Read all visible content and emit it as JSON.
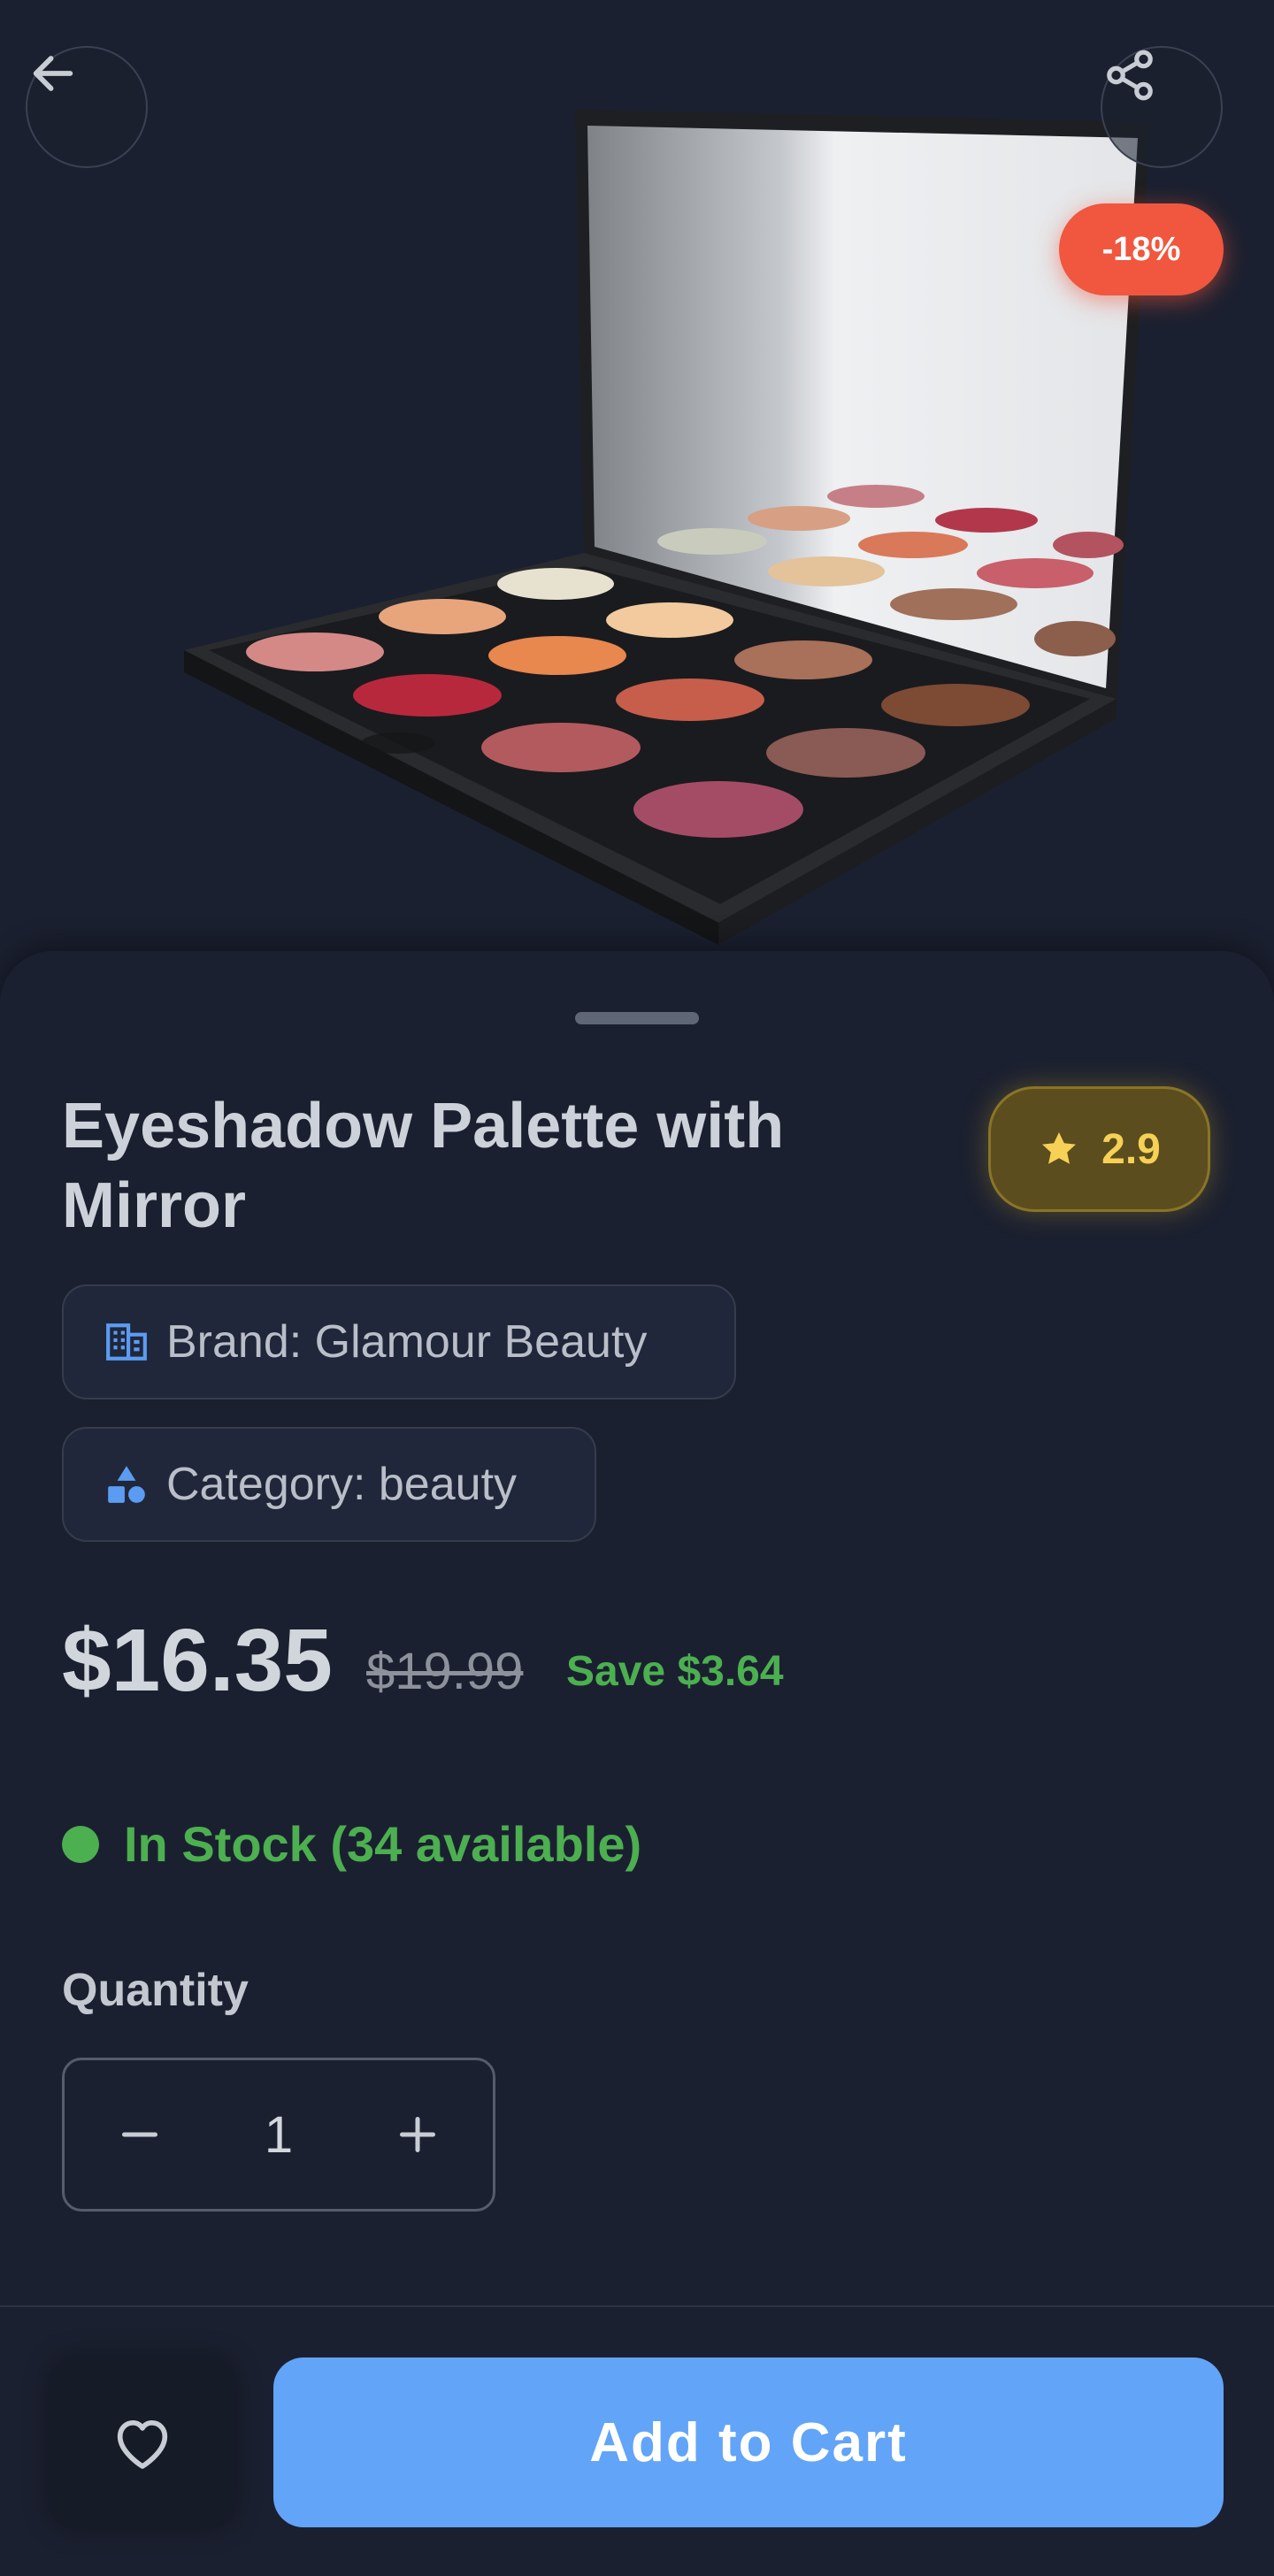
{
  "product": {
    "title": "Eyeshadow Palette with Mirror",
    "discount": "-18%",
    "rating": "2.9",
    "brand": "Brand: Glamour Beauty",
    "category": "Category: beauty",
    "price": "$16.35",
    "original_price": "$19.99",
    "savings": "Save $3.64",
    "stock_status": "In Stock (34 available)"
  },
  "quantity": {
    "label": "Quantity",
    "value": "1"
  },
  "actions": {
    "add_to_cart": "Add to Cart"
  },
  "icons": {
    "back": "arrow-left-icon",
    "share": "share-icon",
    "rating": "star-icon",
    "brand": "building-icon",
    "category": "shapes-icon",
    "decrement": "minus-icon",
    "increment": "plus-icon",
    "favorite": "heart-icon"
  },
  "colors": {
    "background": "#1b2030",
    "accent": "#62a4f7",
    "success": "#4caf50",
    "discount": "#f0573e",
    "rating": "#f6d155"
  }
}
